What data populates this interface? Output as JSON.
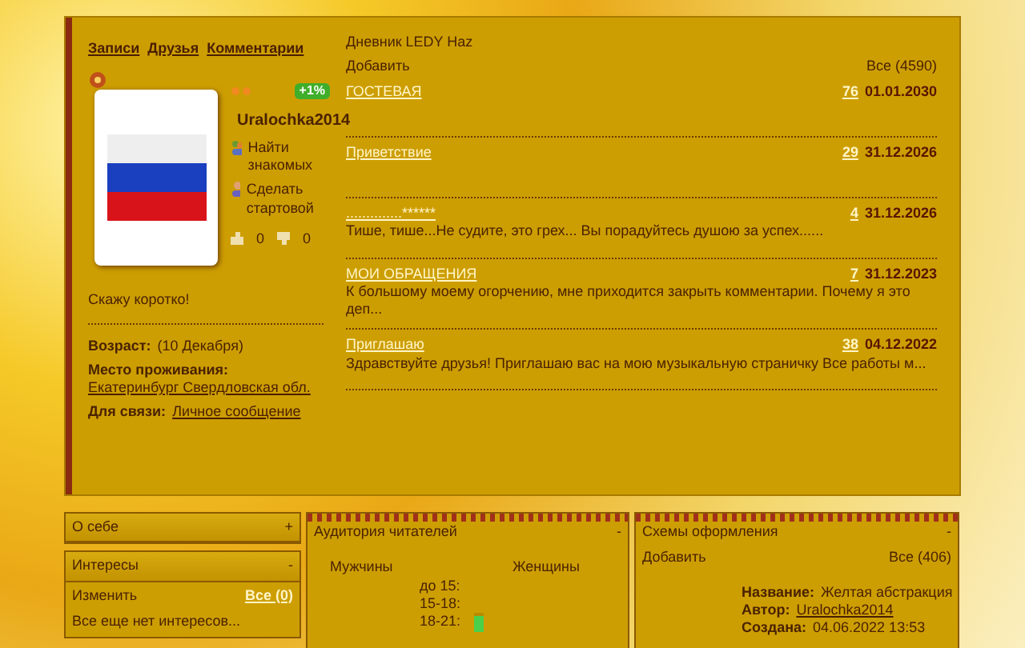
{
  "profile": {
    "tabs": [
      "Записи",
      "Друзья",
      "Комментарии"
    ],
    "rating_badge": "+1%",
    "username": "Uralochka2014",
    "actions": [
      "Найти знакомых",
      "Сделать стартовой"
    ],
    "likes": "0",
    "dislikes": "0",
    "status": "Скажу коротко!",
    "details": [
      {
        "label": "Возраст:",
        "value": "(10 Декабря)",
        "link": false
      },
      {
        "label": "Место проживания:",
        "value": "Екатеринбург Свердловская обл.",
        "link": true
      },
      {
        "label": "Для связи:",
        "value": "Личное сообщение",
        "link": true
      }
    ]
  },
  "diary": {
    "title": "Дневник LEDY Haz",
    "add": "Добавить",
    "all": "Все (4590)",
    "posts": [
      {
        "title": "ГОСТЕВАЯ",
        "comments": "76",
        "date": "01.01.2030"
      },
      {
        "title": "Приветствие",
        "comments": "29",
        "date": "31.12.2026"
      },
      {
        "title": "..............******",
        "comments": "4",
        "date": "31.12.2026",
        "excerpt": "Тише, тише...Не судите, это грех... Вы порадуйтесь душою за успех......"
      },
      {
        "title": "МОИ ОБРАЩЕНИЯ",
        "comments": "7",
        "date": "31.12.2023",
        "excerpt": "К большому моему огорчению, мне приходится закрыть комментарии. Почему я это деп..."
      },
      {
        "title": "Приглашаю",
        "comments": "38",
        "date": "04.12.2022",
        "excerpt": "Здравствуйте друзья! Приглашаю вас на мою музыкальную страничку Все работы м..."
      }
    ]
  },
  "side_panels": [
    {
      "title": "О себе",
      "toggle": "+",
      "expanded": false
    },
    {
      "title": "Интересы",
      "toggle": "-",
      "expanded": true,
      "edit": "Изменить",
      "all": "Все (0)",
      "empty": "Все еще нет интересов..."
    }
  ],
  "audience": {
    "title": "Аудитория читателей",
    "toggle": "-",
    "male": "Мужчины",
    "female": "Женщины",
    "ages": [
      {
        "label": "до 15:"
      },
      {
        "label": "15-18:"
      },
      {
        "label": "18-21:",
        "level": 0.85
      }
    ]
  },
  "themes": {
    "title": "Схемы оформления",
    "toggle": "-",
    "add": "Добавить",
    "all": "Все (406)",
    "fields": [
      {
        "label": "Название:",
        "value": "Желтая абстракция",
        "link": false
      },
      {
        "label": "Автор:",
        "value": "Uralochka2014",
        "link": true
      },
      {
        "label": "Создана:",
        "value": "04.06.2022 13:53",
        "link": false
      }
    ]
  }
}
